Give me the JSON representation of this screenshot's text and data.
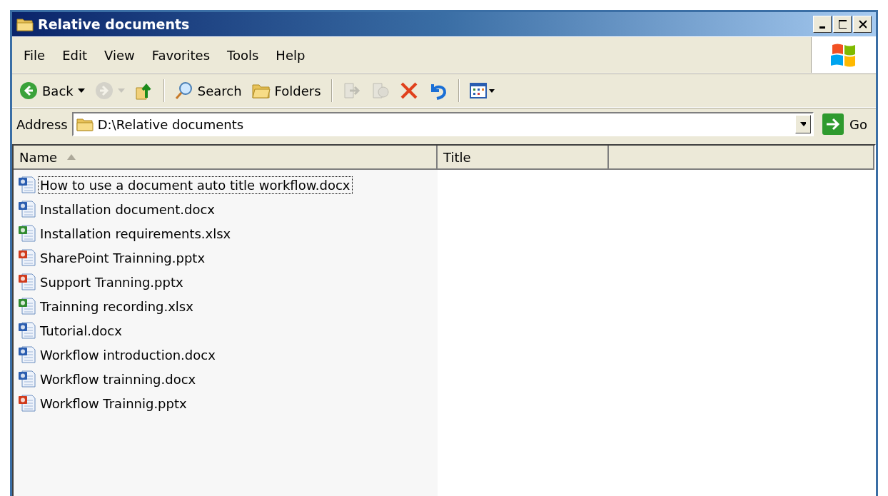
{
  "window": {
    "title": "Relative documents"
  },
  "menu": [
    "File",
    "Edit",
    "View",
    "Favorites",
    "Tools",
    "Help"
  ],
  "toolbar": [
    {
      "kind": "back",
      "label": "Back",
      "disabled": false
    },
    {
      "kind": "forward",
      "disabled": true
    },
    {
      "kind": "up",
      "disabled": false
    },
    {
      "kind": "separator"
    },
    {
      "kind": "search",
      "label": "Search",
      "disabled": false
    },
    {
      "kind": "folders",
      "label": "Folders",
      "disabled": false
    },
    {
      "kind": "separator"
    },
    {
      "kind": "move",
      "disabled": true
    },
    {
      "kind": "copy",
      "disabled": true
    },
    {
      "kind": "delete",
      "disabled": false
    },
    {
      "kind": "undo",
      "disabled": false
    },
    {
      "kind": "separator"
    },
    {
      "kind": "views",
      "disabled": false
    }
  ],
  "address": {
    "label": "Address",
    "value": "D:\\Relative documents",
    "go": "Go"
  },
  "columns": [
    {
      "label": "Name",
      "sorted": true
    },
    {
      "label": "Title",
      "sorted": false
    }
  ],
  "files": [
    {
      "name": "How to use a document auto title workflow.docx",
      "kind": "word",
      "focused": true
    },
    {
      "name": "Installation document.docx",
      "kind": "word",
      "focused": false
    },
    {
      "name": "Installation requirements.xlsx",
      "kind": "excel",
      "focused": false
    },
    {
      "name": "SharePoint Trainning.pptx",
      "kind": "powerpoint",
      "focused": false
    },
    {
      "name": "Support Tranning.pptx",
      "kind": "powerpoint",
      "focused": false
    },
    {
      "name": "Trainning recording.xlsx",
      "kind": "excel",
      "focused": false
    },
    {
      "name": "Tutorial.docx",
      "kind": "word",
      "focused": false
    },
    {
      "name": "Workflow introduction.docx",
      "kind": "word",
      "focused": false
    },
    {
      "name": "Workflow trainning.docx",
      "kind": "word",
      "focused": false
    },
    {
      "name": "Workflow Trainnig.pptx",
      "kind": "powerpoint",
      "focused": false
    }
  ]
}
